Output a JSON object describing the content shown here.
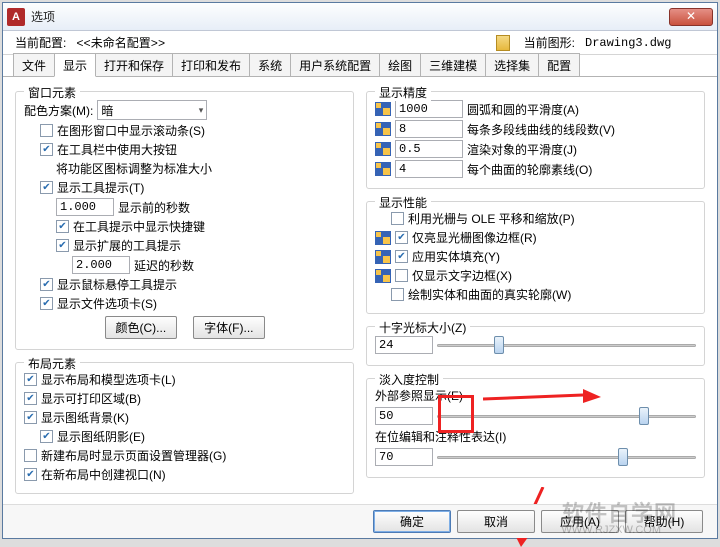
{
  "window": {
    "title": "选项"
  },
  "info": {
    "current_profile_label": "当前配置:",
    "current_profile_value": "<<未命名配置>>",
    "current_drawing_label": "当前图形:",
    "current_drawing_value": "Drawing3.dwg"
  },
  "tabs": [
    "文件",
    "显示",
    "打开和保存",
    "打印和发布",
    "系统",
    "用户系统配置",
    "绘图",
    "三维建模",
    "选择集",
    "配置"
  ],
  "active_tab": 1,
  "left": {
    "g1_title": "窗口元素",
    "color_scheme_label": "配色方案(M):",
    "color_scheme_value": "暗",
    "cb_scrollbars": "在图形窗口中显示滚动条(S)",
    "cb_largebtn": "在工具栏中使用大按钮",
    "cb_stdsize": "将功能区图标调整为标准大小",
    "cb_tooltips": "显示工具提示(T)",
    "tooltip_delay": "1.000",
    "tooltip_delay_label": "显示前的秒数",
    "cb_shortcut": "在工具提示中显示快捷键",
    "cb_ext_tooltip": "显示扩展的工具提示",
    "ext_delay": "2.000",
    "ext_delay_label": "延迟的秒数",
    "cb_hover": "显示鼠标悬停工具提示",
    "cb_filetabs": "显示文件选项卡(S)",
    "btn_color": "颜色(C)...",
    "btn_font": "字体(F)...",
    "g2_title": "布局元素",
    "cb_layout_tabs": "显示布局和模型选项卡(L)",
    "cb_printable": "显示可打印区域(B)",
    "cb_paperbg": "显示图纸背景(K)",
    "cb_papershadow": "显示图纸阴影(E)",
    "cb_pagesetup": "新建布局时显示页面设置管理器(G)",
    "cb_viewport": "在新布局中创建视口(N)"
  },
  "right": {
    "g1_title": "显示精度",
    "arc_val": "1000",
    "arc_label": "圆弧和圆的平滑度(A)",
    "seg_val": "8",
    "seg_label": "每条多段线曲线的线段数(V)",
    "render_val": "0.5",
    "render_label": "渲染对象的平滑度(J)",
    "contour_val": "4",
    "contour_label": "每个曲面的轮廓素线(O)",
    "g2_title": "显示性能",
    "cb_raster": "利用光栅与 OLE 平移和缩放(P)",
    "cb_frame": "仅亮显光栅图像边框(R)",
    "cb_solidfill": "应用实体填充(Y)",
    "cb_textframe": "仅显示文字边框(X)",
    "cb_silhouette": "绘制实体和曲面的真实轮廓(W)",
    "crosshair_label": "十字光标大小(Z)",
    "crosshair_val": "24",
    "fade_title": "淡入度控制",
    "xref_label": "外部参照显示(E)",
    "xref_val": "50",
    "inplace_label": "在位编辑和注释性表达(I)",
    "inplace_val": "70"
  },
  "footer": {
    "ok": "确定",
    "cancel": "取消",
    "apply": "应用(A)",
    "help": "帮助(H)"
  },
  "watermark": {
    "main": "软件自学网",
    "sub": "WWW.RJZXW.COM"
  }
}
